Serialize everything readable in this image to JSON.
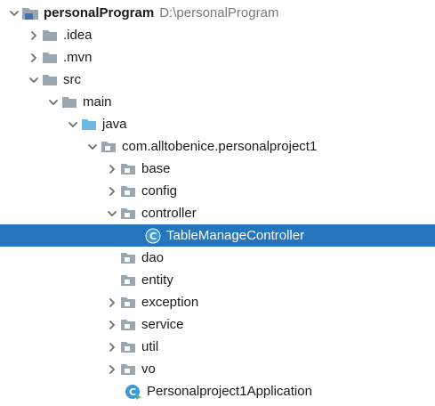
{
  "project_tree": {
    "root": {
      "name": "personalProgram",
      "path": "D:\\personalProgram"
    },
    "nodes": [
      {
        "label": ".idea"
      },
      {
        "label": ".mvn"
      },
      {
        "label": "src"
      },
      {
        "label": "main"
      },
      {
        "label": "java"
      },
      {
        "label": "com.alltobenice.personalproject1"
      },
      {
        "label": "base"
      },
      {
        "label": "config"
      },
      {
        "label": "controller"
      },
      {
        "label": "TableManageController",
        "selected": true
      },
      {
        "label": "dao"
      },
      {
        "label": "entity"
      },
      {
        "label": "exception"
      },
      {
        "label": "service"
      },
      {
        "label": "util"
      },
      {
        "label": "vo"
      },
      {
        "label": "Personalproject1Application"
      }
    ]
  },
  "colors": {
    "selection_background": "#2675bf",
    "folder": "#9aa7b0",
    "source_folder": "#6fb6e0",
    "class_icon": "#3f9ad3"
  },
  "icons": [
    "chevron-right-icon",
    "chevron-down-icon",
    "module-folder-icon",
    "folder-icon",
    "source-folder-icon",
    "package-icon",
    "class-icon",
    "spring-boot-class-icon"
  ]
}
